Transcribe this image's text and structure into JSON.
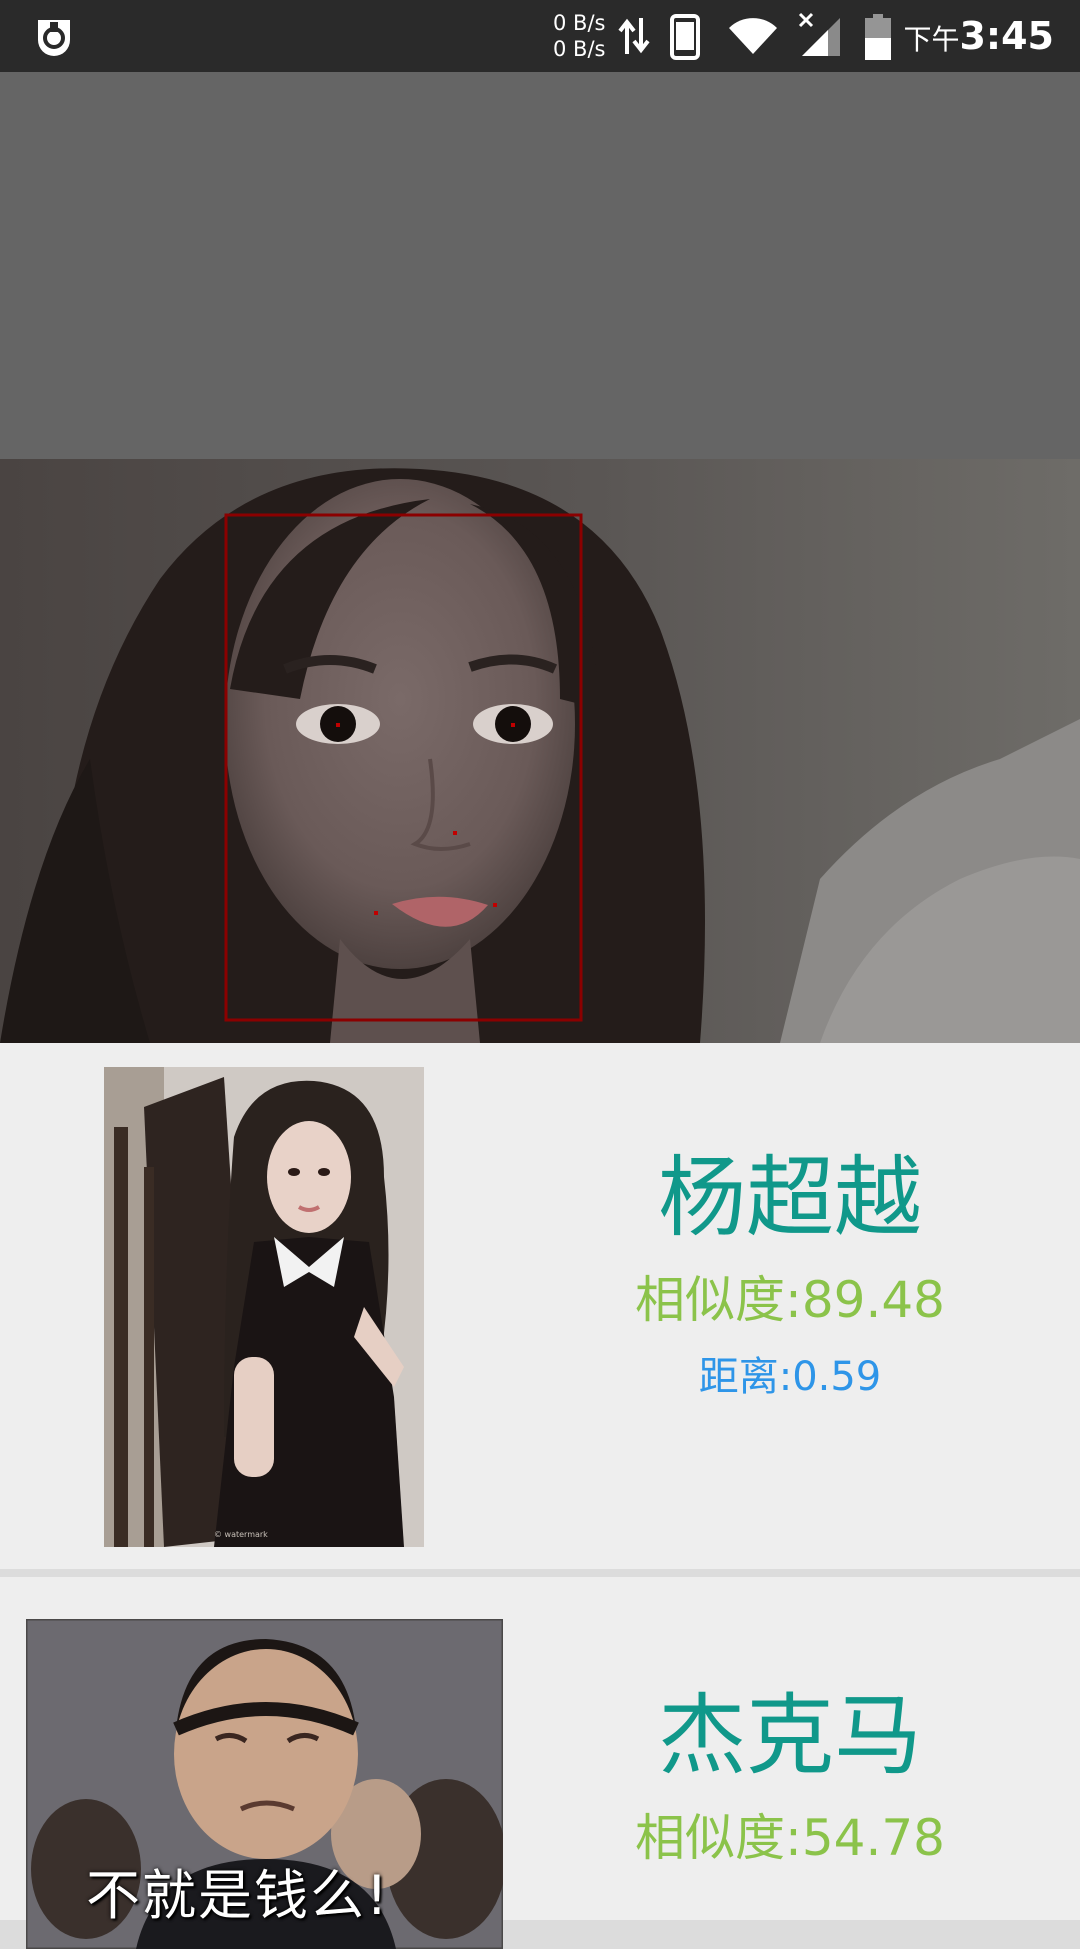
{
  "status_bar": {
    "rate_up": "0 B/s",
    "rate_down": "0 B/s",
    "ampm": "下午",
    "time": "3:45",
    "icons": [
      "app-icon",
      "data-arrows-icon",
      "phone-icon",
      "wifi-icon",
      "signal-icon",
      "battery-icon"
    ]
  },
  "detection": {
    "box_color": "#8b0000"
  },
  "results": [
    {
      "name": "杨超越",
      "similarity": "相似度:89.48",
      "distance": "距离:0.59"
    },
    {
      "name": "杰克马",
      "similarity": "相似度:54.78",
      "meme_caption": "不就是钱么!"
    }
  ],
  "colors": {
    "name": "#10988a",
    "similarity": "#8bc34a",
    "distance": "#2e95e8",
    "status_bar": "#2a2a2a",
    "header_gray": "#656565",
    "card_bg": "#eeeeee"
  }
}
